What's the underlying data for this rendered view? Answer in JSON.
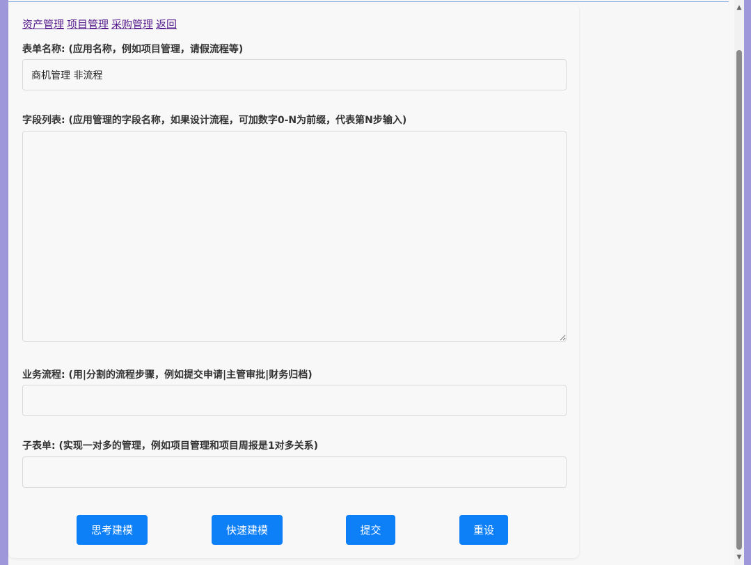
{
  "nav": {
    "links": [
      "资产管理",
      "项目管理",
      "采购管理",
      "返回"
    ]
  },
  "form": {
    "name_label": "表单名称: (应用名称，例如项目管理，请假流程等)",
    "name_value": "商机管理 非流程",
    "fields_label": "字段列表: (应用管理的字段名称，如果设计流程，可加数字0-N为前缀，代表第N步输入)",
    "fields_value": "",
    "workflow_label": "业务流程: (用|分割的流程步骤，例如提交申请|主管审批|财务归档)",
    "workflow_value": "",
    "subform_label": "子表单: (实现一对多的管理，例如项目管理和项目周报是1对多关系)",
    "subform_value": ""
  },
  "buttons": {
    "think_model": "思考建模",
    "quick_model": "快速建模",
    "submit": "提交",
    "reset": "重设"
  },
  "colors": {
    "button_bg": "#0d7ff7",
    "link": "#551a8b",
    "page_bg": "#9e97d9"
  }
}
